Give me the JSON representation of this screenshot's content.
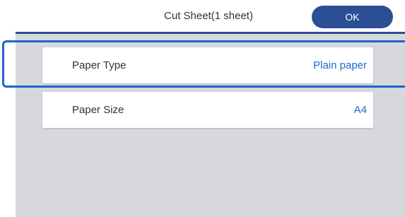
{
  "header": {
    "title": "Cut Sheet(1 sheet)",
    "ok_label": "OK"
  },
  "settings": [
    {
      "label": "Paper Type",
      "value": "Plain paper"
    },
    {
      "label": "Paper Size",
      "value": "A4"
    }
  ],
  "colors": {
    "ok_button": "#2b4f95",
    "value_text": "#1e68c9",
    "highlight": "#1f62cf",
    "panel_background": "#d6d8dc"
  }
}
